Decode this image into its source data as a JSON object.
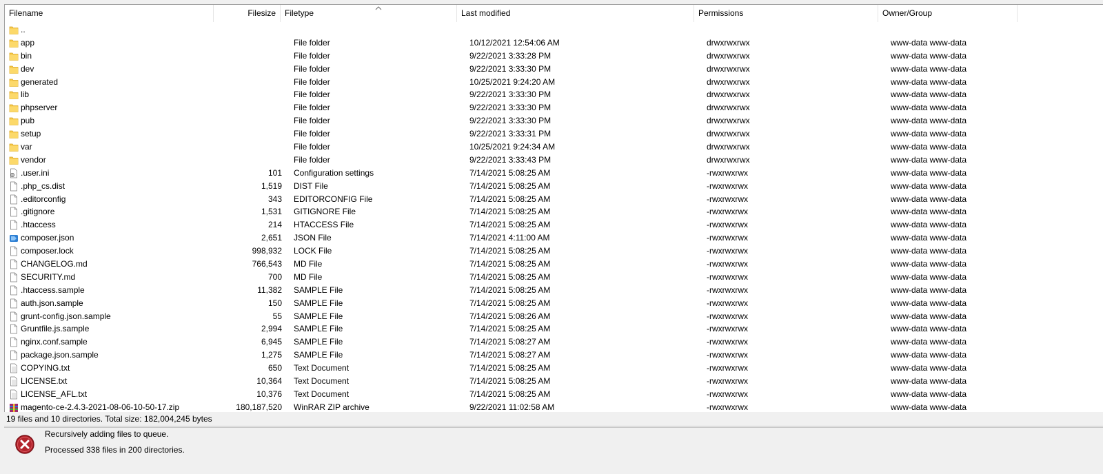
{
  "columns": {
    "filename": "Filename",
    "filesize": "Filesize",
    "filetype": "Filetype",
    "last_modified": "Last modified",
    "permissions": "Permissions",
    "owner_group": "Owner/Group"
  },
  "colors": {
    "folder": "#f7c948",
    "folder_dark": "#d9a520",
    "error_red": "#b3242c",
    "json_blue": "#2d7fd3"
  },
  "files": [
    {
      "name": "..",
      "size": "",
      "type": "",
      "modified": "",
      "perms": "",
      "owner": "",
      "icon": "folder-icon"
    },
    {
      "name": "app",
      "size": "",
      "type": "File folder",
      "modified": "10/12/2021 12:54:06 AM",
      "perms": "drwxrwxrwx",
      "owner": "www-data www-data",
      "icon": "folder-icon"
    },
    {
      "name": "bin",
      "size": "",
      "type": "File folder",
      "modified": "9/22/2021 3:33:28 PM",
      "perms": "drwxrwxrwx",
      "owner": "www-data www-data",
      "icon": "folder-icon"
    },
    {
      "name": "dev",
      "size": "",
      "type": "File folder",
      "modified": "9/22/2021 3:33:30 PM",
      "perms": "drwxrwxrwx",
      "owner": "www-data www-data",
      "icon": "folder-icon"
    },
    {
      "name": "generated",
      "size": "",
      "type": "File folder",
      "modified": "10/25/2021 9:24:20 AM",
      "perms": "drwxrwxrwx",
      "owner": "www-data www-data",
      "icon": "folder-icon"
    },
    {
      "name": "lib",
      "size": "",
      "type": "File folder",
      "modified": "9/22/2021 3:33:30 PM",
      "perms": "drwxrwxrwx",
      "owner": "www-data www-data",
      "icon": "folder-icon"
    },
    {
      "name": "phpserver",
      "size": "",
      "type": "File folder",
      "modified": "9/22/2021 3:33:30 PM",
      "perms": "drwxrwxrwx",
      "owner": "www-data www-data",
      "icon": "folder-icon"
    },
    {
      "name": "pub",
      "size": "",
      "type": "File folder",
      "modified": "9/22/2021 3:33:30 PM",
      "perms": "drwxrwxrwx",
      "owner": "www-data www-data",
      "icon": "folder-icon"
    },
    {
      "name": "setup",
      "size": "",
      "type": "File folder",
      "modified": "9/22/2021 3:33:31 PM",
      "perms": "drwxrwxrwx",
      "owner": "www-data www-data",
      "icon": "folder-icon"
    },
    {
      "name": "var",
      "size": "",
      "type": "File folder",
      "modified": "10/25/2021 9:24:34 AM",
      "perms": "drwxrwxrwx",
      "owner": "www-data www-data",
      "icon": "folder-icon"
    },
    {
      "name": "vendor",
      "size": "",
      "type": "File folder",
      "modified": "9/22/2021 3:33:43 PM",
      "perms": "drwxrwxrwx",
      "owner": "www-data www-data",
      "icon": "folder-icon"
    },
    {
      "name": ".user.ini",
      "size": "101",
      "type": "Configuration settings",
      "modified": "7/14/2021 5:08:25 AM",
      "perms": "-rwxrwxrwx",
      "owner": "www-data www-data",
      "icon": "settings-file-icon"
    },
    {
      "name": ".php_cs.dist",
      "size": "1,519",
      "type": "DIST File",
      "modified": "7/14/2021 5:08:25 AM",
      "perms": "-rwxrwxrwx",
      "owner": "www-data www-data",
      "icon": "file-icon"
    },
    {
      "name": ".editorconfig",
      "size": "343",
      "type": "EDITORCONFIG File",
      "modified": "7/14/2021 5:08:25 AM",
      "perms": "-rwxrwxrwx",
      "owner": "www-data www-data",
      "icon": "file-icon"
    },
    {
      "name": ".gitignore",
      "size": "1,531",
      "type": "GITIGNORE File",
      "modified": "7/14/2021 5:08:25 AM",
      "perms": "-rwxrwxrwx",
      "owner": "www-data www-data",
      "icon": "file-icon"
    },
    {
      "name": ".htaccess",
      "size": "214",
      "type": "HTACCESS File",
      "modified": "7/14/2021 5:08:25 AM",
      "perms": "-rwxrwxrwx",
      "owner": "www-data www-data",
      "icon": "file-icon"
    },
    {
      "name": "composer.json",
      "size": "2,651",
      "type": "JSON File",
      "modified": "7/14/2021 4:11:00 AM",
      "perms": "-rwxrwxrwx",
      "owner": "www-data www-data",
      "icon": "json-file-icon"
    },
    {
      "name": "composer.lock",
      "size": "998,932",
      "type": "LOCK File",
      "modified": "7/14/2021 5:08:25 AM",
      "perms": "-rwxrwxrwx",
      "owner": "www-data www-data",
      "icon": "file-icon"
    },
    {
      "name": "CHANGELOG.md",
      "size": "766,543",
      "type": "MD File",
      "modified": "7/14/2021 5:08:25 AM",
      "perms": "-rwxrwxrwx",
      "owner": "www-data www-data",
      "icon": "file-icon"
    },
    {
      "name": "SECURITY.md",
      "size": "700",
      "type": "MD File",
      "modified": "7/14/2021 5:08:25 AM",
      "perms": "-rwxrwxrwx",
      "owner": "www-data www-data",
      "icon": "file-icon"
    },
    {
      "name": ".htaccess.sample",
      "size": "11,382",
      "type": "SAMPLE File",
      "modified": "7/14/2021 5:08:25 AM",
      "perms": "-rwxrwxrwx",
      "owner": "www-data www-data",
      "icon": "file-icon"
    },
    {
      "name": "auth.json.sample",
      "size": "150",
      "type": "SAMPLE File",
      "modified": "7/14/2021 5:08:25 AM",
      "perms": "-rwxrwxrwx",
      "owner": "www-data www-data",
      "icon": "file-icon"
    },
    {
      "name": "grunt-config.json.sample",
      "size": "55",
      "type": "SAMPLE File",
      "modified": "7/14/2021 5:08:26 AM",
      "perms": "-rwxrwxrwx",
      "owner": "www-data www-data",
      "icon": "file-icon"
    },
    {
      "name": "Gruntfile.js.sample",
      "size": "2,994",
      "type": "SAMPLE File",
      "modified": "7/14/2021 5:08:25 AM",
      "perms": "-rwxrwxrwx",
      "owner": "www-data www-data",
      "icon": "file-icon"
    },
    {
      "name": "nginx.conf.sample",
      "size": "6,945",
      "type": "SAMPLE File",
      "modified": "7/14/2021 5:08:27 AM",
      "perms": "-rwxrwxrwx",
      "owner": "www-data www-data",
      "icon": "file-icon"
    },
    {
      "name": "package.json.sample",
      "size": "1,275",
      "type": "SAMPLE File",
      "modified": "7/14/2021 5:08:27 AM",
      "perms": "-rwxrwxrwx",
      "owner": "www-data www-data",
      "icon": "file-icon"
    },
    {
      "name": "COPYING.txt",
      "size": "650",
      "type": "Text Document",
      "modified": "7/14/2021 5:08:25 AM",
      "perms": "-rwxrwxrwx",
      "owner": "www-data www-data",
      "icon": "text-file-icon"
    },
    {
      "name": "LICENSE.txt",
      "size": "10,364",
      "type": "Text Document",
      "modified": "7/14/2021 5:08:25 AM",
      "perms": "-rwxrwxrwx",
      "owner": "www-data www-data",
      "icon": "text-file-icon"
    },
    {
      "name": "LICENSE_AFL.txt",
      "size": "10,376",
      "type": "Text Document",
      "modified": "7/14/2021 5:08:25 AM",
      "perms": "-rwxrwxrwx",
      "owner": "www-data www-data",
      "icon": "text-file-icon"
    },
    {
      "name": "magento-ce-2.4.3-2021-08-06-10-50-17.zip",
      "size": "180,187,520",
      "type": "WinRAR ZIP archive",
      "modified": "9/22/2021 11:02:58 AM",
      "perms": "-rwxrwxrwx",
      "owner": "www-data www-data",
      "icon": "winrar-archive-icon"
    }
  ],
  "status_bar": "19 files and 10 directories. Total size: 182,004,245 bytes",
  "log": {
    "icon": "error-icon",
    "line1": "Recursively adding files to queue.",
    "line2": "Processed 338 files in 200 directories."
  }
}
